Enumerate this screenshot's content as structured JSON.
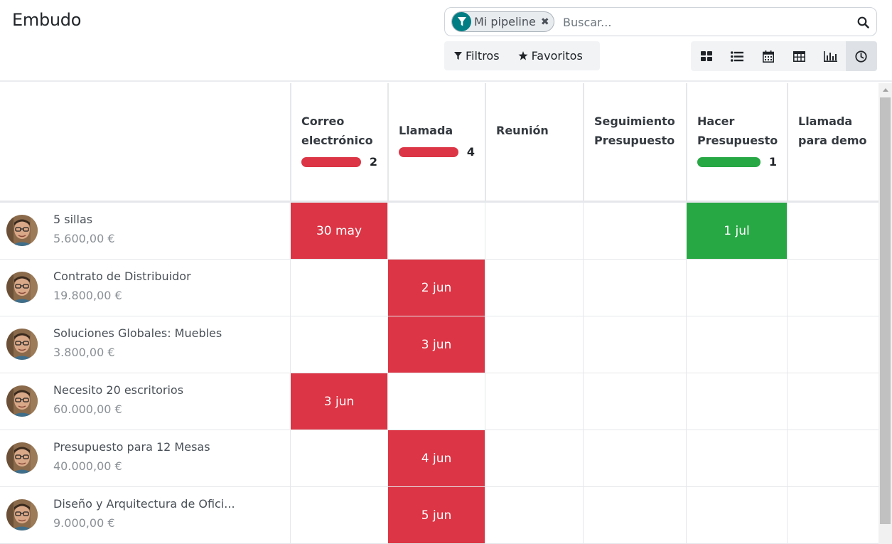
{
  "page": {
    "title": "Embudo"
  },
  "search": {
    "facet_label": "Mi pipeline",
    "placeholder": "Buscar..."
  },
  "filters": {
    "filters_label": "Filtros",
    "favorites_label": "Favoritos"
  },
  "views": [
    {
      "name": "kanban",
      "icon": "kanban-icon"
    },
    {
      "name": "list",
      "icon": "list-icon"
    },
    {
      "name": "calendar",
      "icon": "calendar-icon"
    },
    {
      "name": "pivot",
      "icon": "pivot-icon"
    },
    {
      "name": "graph",
      "icon": "graph-icon"
    },
    {
      "name": "activity",
      "icon": "clock-icon",
      "active": true
    }
  ],
  "columns": [
    {
      "name": "Correo electrónico",
      "count": "2",
      "bar_color": "red",
      "bar_fraction": 1.0
    },
    {
      "name": "Llamada",
      "count": "4",
      "bar_color": "red",
      "bar_fraction": 1.0
    },
    {
      "name": "Reunión",
      "count": "",
      "bar_color": "",
      "bar_fraction": 0
    },
    {
      "name": "Seguimiento Presupuesto",
      "count": "",
      "bar_color": "",
      "bar_fraction": 0
    },
    {
      "name": "Hacer Presupuesto",
      "count": "1",
      "bar_color": "green",
      "bar_fraction": 1.0
    },
    {
      "name": "Llamada para demo",
      "count": "",
      "bar_color": "",
      "bar_fraction": 0
    }
  ],
  "rows": [
    {
      "title": "5 sillas",
      "amount": "5.600,00 €",
      "cells": [
        {
          "col": 0,
          "date": "30 may",
          "color": "red"
        },
        {
          "col": 4,
          "date": "1 jul",
          "color": "green"
        }
      ]
    },
    {
      "title": "Contrato de Distribuidor",
      "amount": "19.800,00 €",
      "cells": [
        {
          "col": 1,
          "date": "2 jun",
          "color": "red"
        }
      ]
    },
    {
      "title": "Soluciones Globales: Muebles",
      "amount": "3.800,00 €",
      "cells": [
        {
          "col": 1,
          "date": "3 jun",
          "color": "red"
        }
      ]
    },
    {
      "title": "Necesito 20 escritorios",
      "amount": "60.000,00 €",
      "cells": [
        {
          "col": 0,
          "date": "3 jun",
          "color": "red"
        }
      ]
    },
    {
      "title": "Presupuesto para 12 Mesas",
      "amount": "40.000,00 €",
      "cells": [
        {
          "col": 1,
          "date": "4 jun",
          "color": "red"
        }
      ]
    },
    {
      "title": "Diseño y Arquitectura de Ofici...",
      "amount": "9.000,00 €",
      "cells": [
        {
          "col": 1,
          "date": "5 jun",
          "color": "red"
        }
      ]
    }
  ],
  "colors": {
    "overdue": "#dc3545",
    "planned": "#28a745",
    "facet_icon": "#017e84"
  }
}
